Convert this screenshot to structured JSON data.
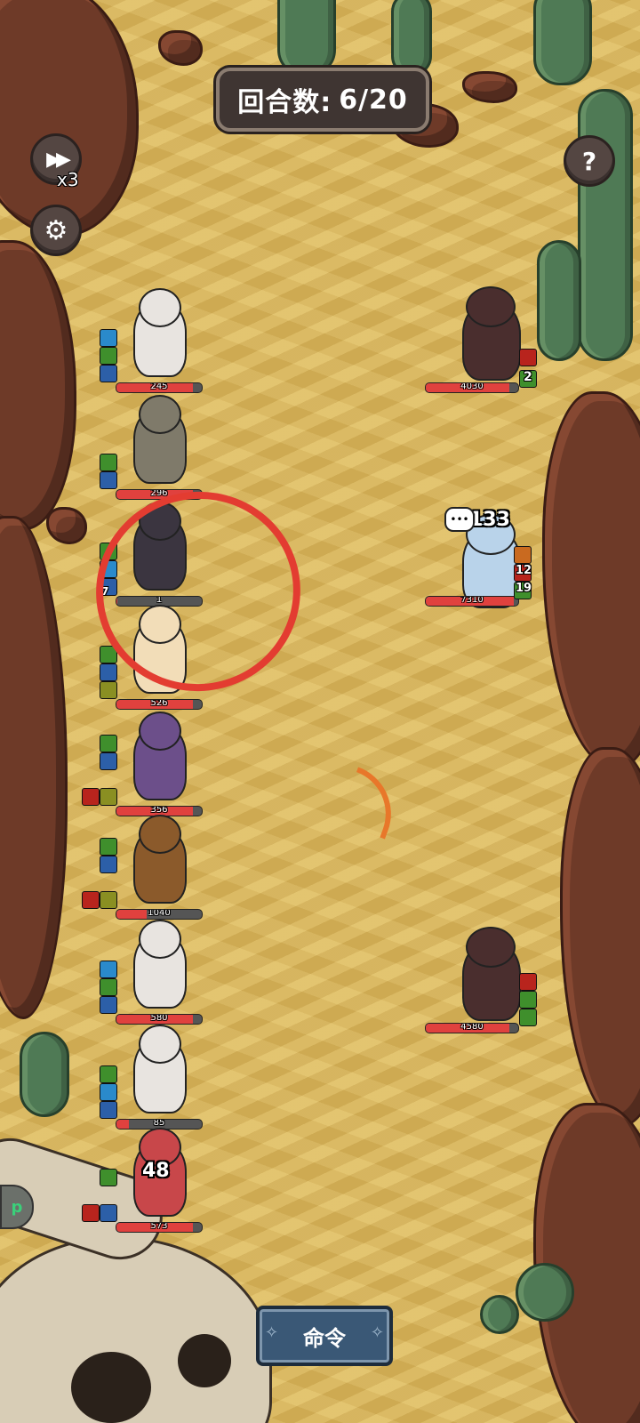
{
  "hud": {
    "round_label": "回合数:",
    "round_value": "6/20",
    "speed_multiplier": "x3",
    "help_glyph": "?",
    "command_label": "命令",
    "side_tab_glyph": "p"
  },
  "allies": [
    {
      "name": "skeleton-warrior",
      "hp": "245",
      "fill": 0.9,
      "statuses": [
        "ice",
        "green",
        "blue"
      ]
    },
    {
      "name": "armored-knight",
      "hp": "296",
      "fill": 0.9,
      "statuses": [
        "green",
        "blue"
      ]
    },
    {
      "name": "dark-mage-girl",
      "hp": "1",
      "fill": 0.01,
      "statuses": [
        "green",
        "ice",
        "blue"
      ],
      "stack": "7"
    },
    {
      "name": "blonde-archer",
      "hp": "526",
      "fill": 0.9,
      "statuses": [
        "green",
        "blue",
        "yellow"
      ]
    },
    {
      "name": "hooded-necromancer",
      "hp": "356",
      "fill": 0.9,
      "statuses": [
        "green",
        "blue",
        "red",
        "yellow"
      ]
    },
    {
      "name": "brown-haired-fighter",
      "hp": "1040",
      "fill": 0.35,
      "statuses": [
        "green",
        "blue",
        "red",
        "yellow"
      ]
    },
    {
      "name": "skeleton-warrior-2",
      "hp": "580",
      "fill": 0.9,
      "statuses": [
        "ice",
        "green",
        "blue"
      ]
    },
    {
      "name": "skeleton-warrior-3",
      "hp": "85",
      "fill": 0.15,
      "statuses": [
        "green",
        "ice",
        "blue"
      ]
    },
    {
      "name": "red-imp",
      "hp": "573",
      "fill": 0.9,
      "statuses": [
        "green",
        "red",
        "blue"
      ],
      "damage": "48"
    }
  ],
  "enemies": [
    {
      "name": "horned-demon",
      "hp": "4030",
      "fill": 0.9,
      "status_count": "2"
    },
    {
      "name": "ice-golem",
      "hp": "7310",
      "fill": 0.95,
      "damage": "133",
      "stack_a": "12",
      "stack_b": "19"
    },
    {
      "name": "horned-demon-2",
      "hp": "4580",
      "fill": 0.9
    }
  ]
}
